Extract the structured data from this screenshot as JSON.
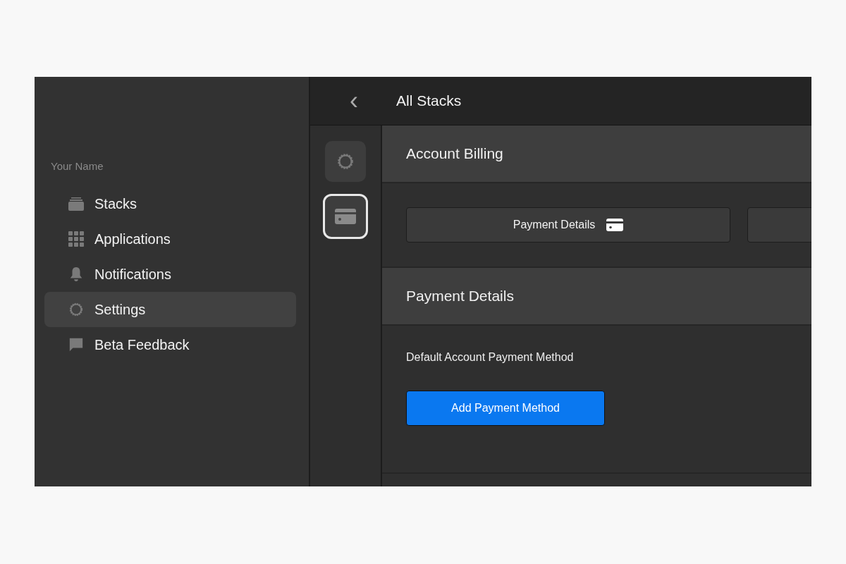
{
  "sidebar": {
    "user_name": "Your Name",
    "items": [
      {
        "label": "Stacks",
        "kind": "stack",
        "selected": false
      },
      {
        "label": "Applications",
        "kind": "grid",
        "selected": false
      },
      {
        "label": "Notifications",
        "kind": "bell",
        "selected": false
      },
      {
        "label": "Settings",
        "kind": "gear",
        "selected": true
      },
      {
        "label": "Beta Feedback",
        "kind": "chat",
        "selected": false
      }
    ]
  },
  "header": {
    "back": "‹",
    "title": "All Stacks"
  },
  "rail": [
    {
      "kind": "gear",
      "selected": false
    },
    {
      "kind": "card",
      "selected": true
    }
  ],
  "sections": [
    {
      "title": "Account Billing",
      "kind": "buttons",
      "buttons": [
        {
          "label": "Payment Details",
          "kind": "card"
        },
        {
          "kind": "blank"
        }
      ]
    },
    {
      "title": "Payment Details",
      "kind": "method",
      "label": "Default Account Payment Method",
      "action": "Add Payment Method"
    }
  ]
}
